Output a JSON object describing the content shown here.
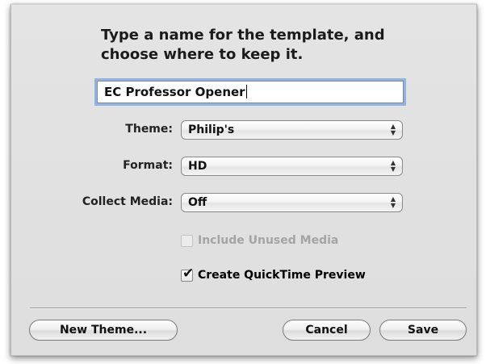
{
  "dialog": {
    "prompt_line1": "Type a name for the template, and",
    "prompt_line2": "choose where to keep it.",
    "name_value": "EC Professor Opener",
    "theme": {
      "label": "Theme:",
      "value": "Philip's"
    },
    "format": {
      "label": "Format:",
      "value": "HD"
    },
    "collect_media": {
      "label": "Collect Media:",
      "value": "Off"
    },
    "include_unused": {
      "label": "Include Unused Media",
      "checked": false,
      "enabled": false
    },
    "create_preview": {
      "label": "Create QuickTime Preview",
      "checked": true,
      "enabled": true
    },
    "buttons": {
      "new_theme": "New Theme...",
      "cancel": "Cancel",
      "save": "Save"
    }
  },
  "icons": {
    "popup_arrows": "up-down-arrows-icon",
    "checkmark": "checkmark-icon"
  }
}
